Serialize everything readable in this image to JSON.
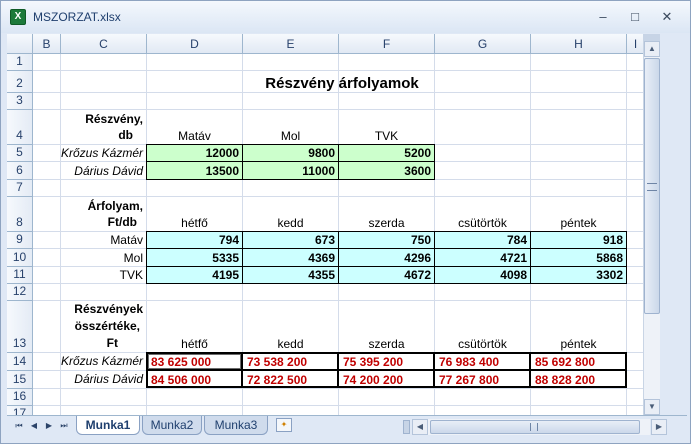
{
  "window": {
    "title": "MSZORZAT.xlsx",
    "app_icon": "excel-icon",
    "minimize_glyph": "–",
    "maximize_glyph": "□",
    "close_glyph": "✕"
  },
  "columns": [
    "B",
    "C",
    "D",
    "E",
    "F",
    "G",
    "H",
    "I"
  ],
  "rows": [
    "1",
    "2",
    "3",
    "4",
    "5",
    "6",
    "7",
    "8",
    "9",
    "10",
    "11",
    "12",
    "13",
    "14",
    "15",
    "16",
    "17"
  ],
  "sheet": {
    "title": "Részvény árfolyamok",
    "shares_header": [
      "Részvény,",
      "db"
    ],
    "share_names": [
      "Matáv",
      "Mol",
      "TVK"
    ],
    "holders": [
      {
        "name": "Krőzus Kázmér",
        "qty": [
          "12000",
          "9800",
          "5200"
        ]
      },
      {
        "name": "Dárius Dávid",
        "qty": [
          "13500",
          "11000",
          "3600"
        ]
      }
    ],
    "rates_header": [
      "Árfolyam,",
      "Ft/db"
    ],
    "days": [
      "hétfő",
      "kedd",
      "szerda",
      "csütörtök",
      "péntek"
    ],
    "rates": [
      {
        "name": "Matáv",
        "values": [
          "794",
          "673",
          "750",
          "784",
          "918"
        ]
      },
      {
        "name": "Mol",
        "values": [
          "5335",
          "4369",
          "4296",
          "4721",
          "5868"
        ]
      },
      {
        "name": "TVK",
        "values": [
          "4195",
          "4355",
          "4672",
          "4098",
          "3302"
        ]
      }
    ],
    "total_header": [
      "Részvények",
      "összértéke,",
      "Ft"
    ],
    "totals": [
      {
        "name": "Krőzus Kázmér",
        "values": [
          "83 625 000",
          "73 538 200",
          "75 395 200",
          "76 983 400",
          "85 692 800"
        ]
      },
      {
        "name": "Dárius Dávid",
        "values": [
          "84 506 000",
          "72 822 500",
          "74 200 200",
          "77 267 800",
          "88 828 200"
        ]
      }
    ]
  },
  "tabs": {
    "nav_first": "⏮",
    "nav_prev": "◀",
    "nav_next": "▶",
    "nav_last": "⏭",
    "sheets": [
      "Munka1",
      "Munka2",
      "Munka3"
    ],
    "active": "Munka1"
  },
  "colors": {
    "quantity_fill": "#ccffcc",
    "rate_fill": "#ccffff",
    "total_text": "#c00000"
  }
}
